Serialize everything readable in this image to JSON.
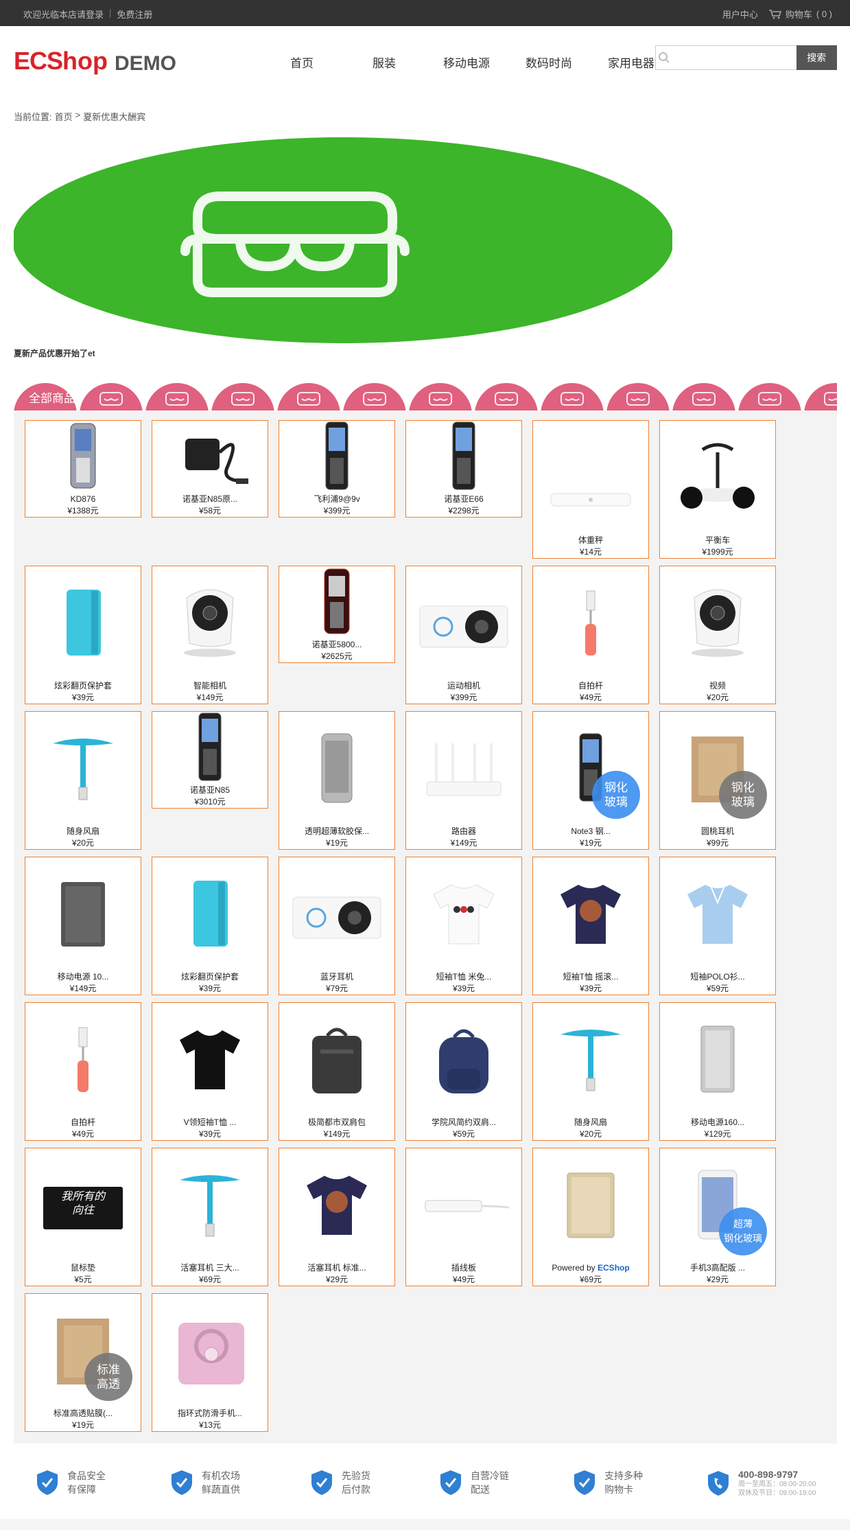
{
  "topbar": {
    "welcome": "欢迎光临本店请登录",
    "sep": "|",
    "register": "免费注册",
    "user_center": "用户中心",
    "cart_label": "购物车",
    "cart_count": "( 0 )"
  },
  "header": {
    "logo_ec": "ECS",
    "logo_shop": "hop",
    "logo_demo": "DEMO",
    "nav": [
      "首页",
      "服装",
      "移动电源",
      "数码时尚",
      "家用电器"
    ],
    "search_placeholder": "",
    "search_button": "搜索"
  },
  "breadcrumb": {
    "prefix": "当前位置:",
    "home": "首页",
    "arrow": ">",
    "current": "夏新优惠大酬宾"
  },
  "promo_text": "夏新产品优惠开始了et",
  "tab_label": "全部商品",
  "colors": {
    "accent": "#f08030",
    "tab_pink": "#e0607f",
    "banner_green": "#3cb52a",
    "topbar": "#333333",
    "blue_badge": "#3b8ff0",
    "gray_badge": "#777777"
  },
  "products": [
    {
      "name": "KD876",
      "price": "¥1388元",
      "icon": "phone-gray"
    },
    {
      "name": "诺基亚N85原...",
      "price": "¥58元",
      "icon": "charger"
    },
    {
      "name": "飞利浦9@9v",
      "price": "¥399元",
      "icon": "phone-black"
    },
    {
      "name": "诺基亚E66",
      "price": "¥2298元",
      "icon": "phone-black"
    },
    {
      "name": "体重秤",
      "price": "¥14元",
      "icon": "scale"
    },
    {
      "name": "平衡车",
      "price": "¥1999元",
      "icon": "balance-scooter"
    },
    {
      "name": "炫彩翻页保护套",
      "price": "¥39元",
      "icon": "cyan-case"
    },
    {
      "name": "智能相机",
      "price": "¥149元",
      "icon": "smart-camera"
    },
    {
      "name": "诺基亚5800...",
      "price": "¥2625元",
      "icon": "phone-red"
    },
    {
      "name": "运动相机",
      "price": "¥399元",
      "icon": "action-camera"
    },
    {
      "name": "自拍杆",
      "price": "¥49元",
      "icon": "selfie-stick"
    },
    {
      "name": "视频",
      "price": "¥20元",
      "icon": "smart-camera"
    },
    {
      "name": "随身风扇",
      "price": "¥20元",
      "icon": "usb-fan"
    },
    {
      "name": "诺基亚N85",
      "price": "¥3010元",
      "icon": "phone-black"
    },
    {
      "name": "透明超薄软胶保...",
      "price": "¥19元",
      "icon": "silver-phone"
    },
    {
      "name": "路由器",
      "price": "¥149元",
      "icon": "router"
    },
    {
      "name": "Note3 钢...",
      "price": "¥19元",
      "icon": "phone-black",
      "badge": "钢化\n玻璃",
      "badge_color": "blue"
    },
    {
      "name": "圆桃耳机",
      "price": "¥99元",
      "icon": "film-box",
      "badge": "钢化\n玻璃",
      "badge_color": "gray"
    },
    {
      "name": "移动电源 10...",
      "price": "¥149元",
      "icon": "power-bank-dark"
    },
    {
      "name": "炫彩翻页保护套",
      "price": "¥39元",
      "icon": "cyan-case"
    },
    {
      "name": "蓝牙耳机",
      "price": "¥79元",
      "icon": "action-camera"
    },
    {
      "name": "短袖T恤 米兔...",
      "price": "¥39元",
      "icon": "white-tshirt"
    },
    {
      "name": "短袖T恤 摇滚...",
      "price": "¥39元",
      "icon": "navy-tshirt"
    },
    {
      "name": "短袖POLO衫...",
      "price": "¥59元",
      "icon": "polo"
    },
    {
      "name": "自拍杆",
      "price": "¥49元",
      "icon": "selfie-stick"
    },
    {
      "name": "V领短袖T恤 ...",
      "price": "¥39元",
      "icon": "black-tshirt"
    },
    {
      "name": "极简都市双肩包",
      "price": "¥149元",
      "icon": "gray-backpack"
    },
    {
      "name": "学院风简约双肩...",
      "price": "¥59元",
      "icon": "navy-backpack"
    },
    {
      "name": "随身风扇",
      "price": "¥20元",
      "icon": "usb-fan"
    },
    {
      "name": "移动电源160...",
      "price": "¥129元",
      "icon": "power-bank-silver"
    },
    {
      "name": "鼠标垫",
      "price": "¥5元",
      "icon": "mouse-pad",
      "pad_text": "我所有的\n向往"
    },
    {
      "name": "活塞耳机 三大...",
      "price": "¥69元",
      "icon": "usb-fan"
    },
    {
      "name": "活塞耳机 标准...",
      "price": "¥29元",
      "icon": "navy-tshirt"
    },
    {
      "name": "插线板",
      "price": "¥49元",
      "icon": "power-strip"
    },
    {
      "name": "Powered by ",
      "name_link": "ECShop",
      "price": "¥69元",
      "icon": "power-bank-gold"
    },
    {
      "name": "手机3高配版 ...",
      "price": "¥29元",
      "icon": "white-phone",
      "badge": "超薄\n钢化玻璃",
      "badge_color": "blue"
    },
    {
      "name": "标准高透贴膜(...",
      "price": "¥19元",
      "icon": "film-box",
      "badge": "标准\n高透",
      "badge_color": "gray"
    },
    {
      "name": "指环式防滑手机...",
      "price": "¥13元",
      "icon": "ring-holder"
    }
  ],
  "footer": {
    "items": [
      {
        "line1": "食品安全",
        "line2": "有保障"
      },
      {
        "line1": "有机农场",
        "line2": "鲜蔬直供"
      },
      {
        "line1": "先验货",
        "line2": "后付款"
      },
      {
        "line1": "自营冷链",
        "line2": "配送"
      },
      {
        "line1": "支持多种",
        "line2": "购物卡"
      }
    ],
    "phone": "400-898-9797",
    "hours1": "周一至周五：08:00-20:00",
    "hours2": "双休及节日：09:00-19:00"
  }
}
